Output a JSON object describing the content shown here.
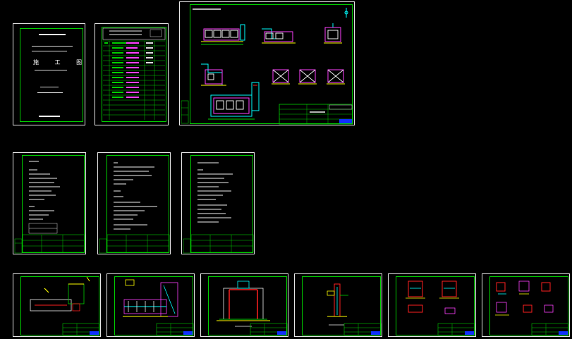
{
  "cover": {
    "title": "施 工 图"
  },
  "colors": {
    "background": "#000000",
    "sheet_border": "#e8e8e8",
    "frame": "#00d000",
    "text": "#f0f0f0",
    "magenta": "#ff40ff",
    "red": "#ff2020",
    "yellow": "#ffff00",
    "cyan": "#00ffff",
    "blue": "#1030ff"
  }
}
